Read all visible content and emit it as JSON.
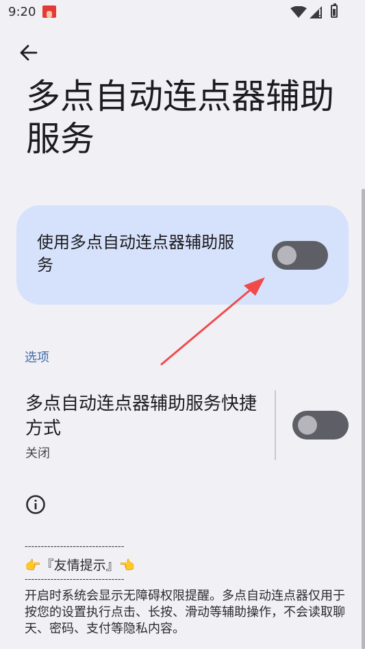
{
  "status_bar": {
    "time": "9:20",
    "icons": [
      "notification-app-icon",
      "wifi-icon",
      "signal-icon",
      "battery-icon"
    ]
  },
  "header": {
    "title": "多点自动连点器辅助服务",
    "back_icon": "arrow-back-icon"
  },
  "main_card": {
    "label": "使用多点自动连点器辅助服务",
    "toggle_on": false,
    "background": "#d6e2fb"
  },
  "options": {
    "section_label": "选项",
    "shortcut": {
      "title": "多点自动连点器辅助服务快捷方式",
      "summary": "关闭",
      "toggle_on": false
    }
  },
  "footer": {
    "info_icon": "info-icon",
    "divider_top": "-------------------------------",
    "tip_title": "👉『友情提示』👈",
    "divider_bottom": "-------------------------------",
    "tip_body": " 开启时系统会显示无障碍权限提醒。多点自动连点器仅用于按您的设置执行点击、长按、滑动等辅助操作，不会读取聊天、密码、支付等隐私内容。"
  },
  "colors": {
    "accent": "#3f6aa8",
    "annotation_arrow": "#ef4b4b",
    "toggle_track": "#5e5e66"
  }
}
